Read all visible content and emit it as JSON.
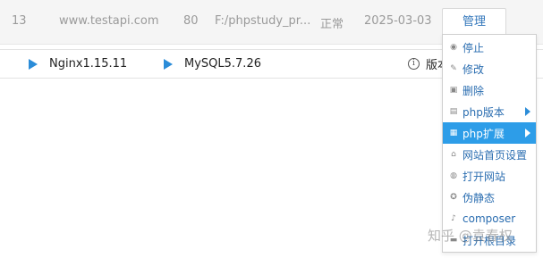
{
  "site_row": {
    "id": "13",
    "domain": "www.testapi.com",
    "port": "80",
    "path": "F:/phpstudy_pr...",
    "status": "正常",
    "date": "2025-03-03",
    "manage_label": "管理"
  },
  "status_bar": {
    "services": [
      {
        "label": "Nginx1.15.11",
        "icon": "play-icon"
      },
      {
        "label": "MySQL5.7.26",
        "icon": "play-icon"
      }
    ],
    "version_label": "版本",
    "version_icon": "info-icon"
  },
  "menu": {
    "items": [
      {
        "label": "停止",
        "icon": "stop-icon",
        "submenu": false,
        "active": false
      },
      {
        "label": "修改",
        "icon": "edit-icon",
        "submenu": false,
        "active": false
      },
      {
        "label": "删除",
        "icon": "trash-icon",
        "submenu": false,
        "active": false
      },
      {
        "label": "php版本",
        "icon": "php-version-icon",
        "submenu": true,
        "active": false
      },
      {
        "label": "php扩展",
        "icon": "php-extension-icon",
        "submenu": true,
        "active": true
      },
      {
        "label": "网站首页设置",
        "icon": "home-icon",
        "submenu": false,
        "active": false
      },
      {
        "label": "打开网站",
        "icon": "globe-icon",
        "submenu": false,
        "active": false
      },
      {
        "label": "伪静态",
        "icon": "rewrite-icon",
        "submenu": false,
        "active": false
      },
      {
        "label": "composer",
        "icon": "composer-icon",
        "submenu": false,
        "active": false
      },
      {
        "label": "打开根目录",
        "icon": "folder-icon",
        "submenu": false,
        "active": false
      }
    ]
  },
  "watermark": "知乎 @袁春权",
  "colors": {
    "accent": "#2d9de8",
    "link": "#2a6db0",
    "play": "#2b8cd8",
    "row_bg": "#f5f5f5"
  }
}
